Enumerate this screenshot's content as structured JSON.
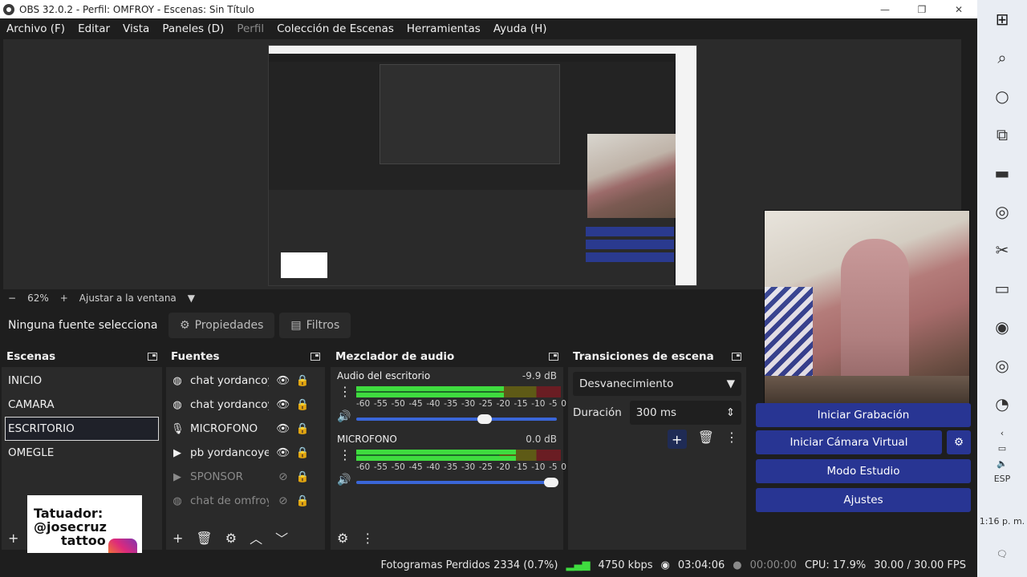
{
  "window": {
    "title": "OBS 32.0.2 - Perfil: OMFROY - Escenas: Sin Título",
    "minimize": "—",
    "maximize": "❐",
    "close": "✕"
  },
  "menu": {
    "items": [
      {
        "label": "Archivo (F)",
        "disabled": false
      },
      {
        "label": "Editar",
        "disabled": false
      },
      {
        "label": "Vista",
        "disabled": false
      },
      {
        "label": "Paneles (D)",
        "disabled": false
      },
      {
        "label": "Perfil",
        "disabled": true
      },
      {
        "label": "Colección de Escenas",
        "disabled": false
      },
      {
        "label": "Herramientas",
        "disabled": false
      },
      {
        "label": "Ayuda (H)",
        "disabled": false
      }
    ]
  },
  "zoom": {
    "minus": "−",
    "value": "62%",
    "plus": "+",
    "fit": "Ajustar a la ventana",
    "dropdown": "▼"
  },
  "context": {
    "no_selection": "Ninguna fuente selecciona",
    "properties": "Propiedades",
    "filters": "Filtros"
  },
  "scenes": {
    "title": "Escenas",
    "items": [
      {
        "label": "INICIO",
        "active": false
      },
      {
        "label": "CAMARA",
        "active": false
      },
      {
        "label": "ESCRITORIO",
        "active": true
      },
      {
        "label": "OMEGLE",
        "active": false
      }
    ]
  },
  "sources": {
    "title": "Fuentes",
    "items": [
      {
        "icon": "globe-icon",
        "glyph": "◍",
        "label": "chat yordancoy",
        "visible": true,
        "locked": true
      },
      {
        "icon": "globe-icon",
        "glyph": "◍",
        "label": "chat yordancoy",
        "visible": true,
        "locked": true
      },
      {
        "icon": "microphone-icon",
        "glyph": "🎙",
        "label": "MICROFONO",
        "visible": true,
        "locked": true
      },
      {
        "icon": "play-icon",
        "glyph": "▶",
        "label": "pb yordancoye",
        "visible": true,
        "locked": true
      },
      {
        "icon": "play-icon",
        "glyph": "▶",
        "label": "SPONSOR",
        "visible": false,
        "locked": true
      },
      {
        "icon": "globe-icon",
        "glyph": "◍",
        "label": "chat de omfroy",
        "visible": false,
        "locked": true
      }
    ]
  },
  "mixer": {
    "title": "Mezclador de audio",
    "scale": [
      "-60",
      "-55",
      "-50",
      "-45",
      "-40",
      "-35",
      "-30",
      "-25",
      "-20",
      "-15",
      "-10",
      "-5",
      "0"
    ],
    "tracks": [
      {
        "name": "Audio del escritorio",
        "db": "-9.9 dB",
        "level": 0.72,
        "volume": 0.64
      },
      {
        "name": "MICROFONO",
        "db": "0.0 dB",
        "level": 0.78,
        "volume": 0.97
      }
    ]
  },
  "transitions": {
    "title": "Transiciones de escena",
    "selected": "Desvanecimiento",
    "duration_label": "Duración",
    "duration_value": "300 ms"
  },
  "controls": {
    "record": "Iniciar Grabación",
    "virtual_cam": "Iniciar Cámara Virtual",
    "studio": "Modo Estudio",
    "settings": "Ajustes"
  },
  "logo": {
    "line1": "Tatuador:",
    "line2": "@josecruz",
    "line3": "tattoo"
  },
  "status": {
    "dropped": "Fotogramas Perdidos 2334 (0.7%)",
    "bitrate": "4750 kbps",
    "stream_time": "03:04:06",
    "rec_time": "00:00:00",
    "cpu": "CPU: 17.9%",
    "fps": "30.00 / 30.00 FPS"
  },
  "taskbar": {
    "lang": "ESP",
    "time": "1:16 p. m."
  }
}
